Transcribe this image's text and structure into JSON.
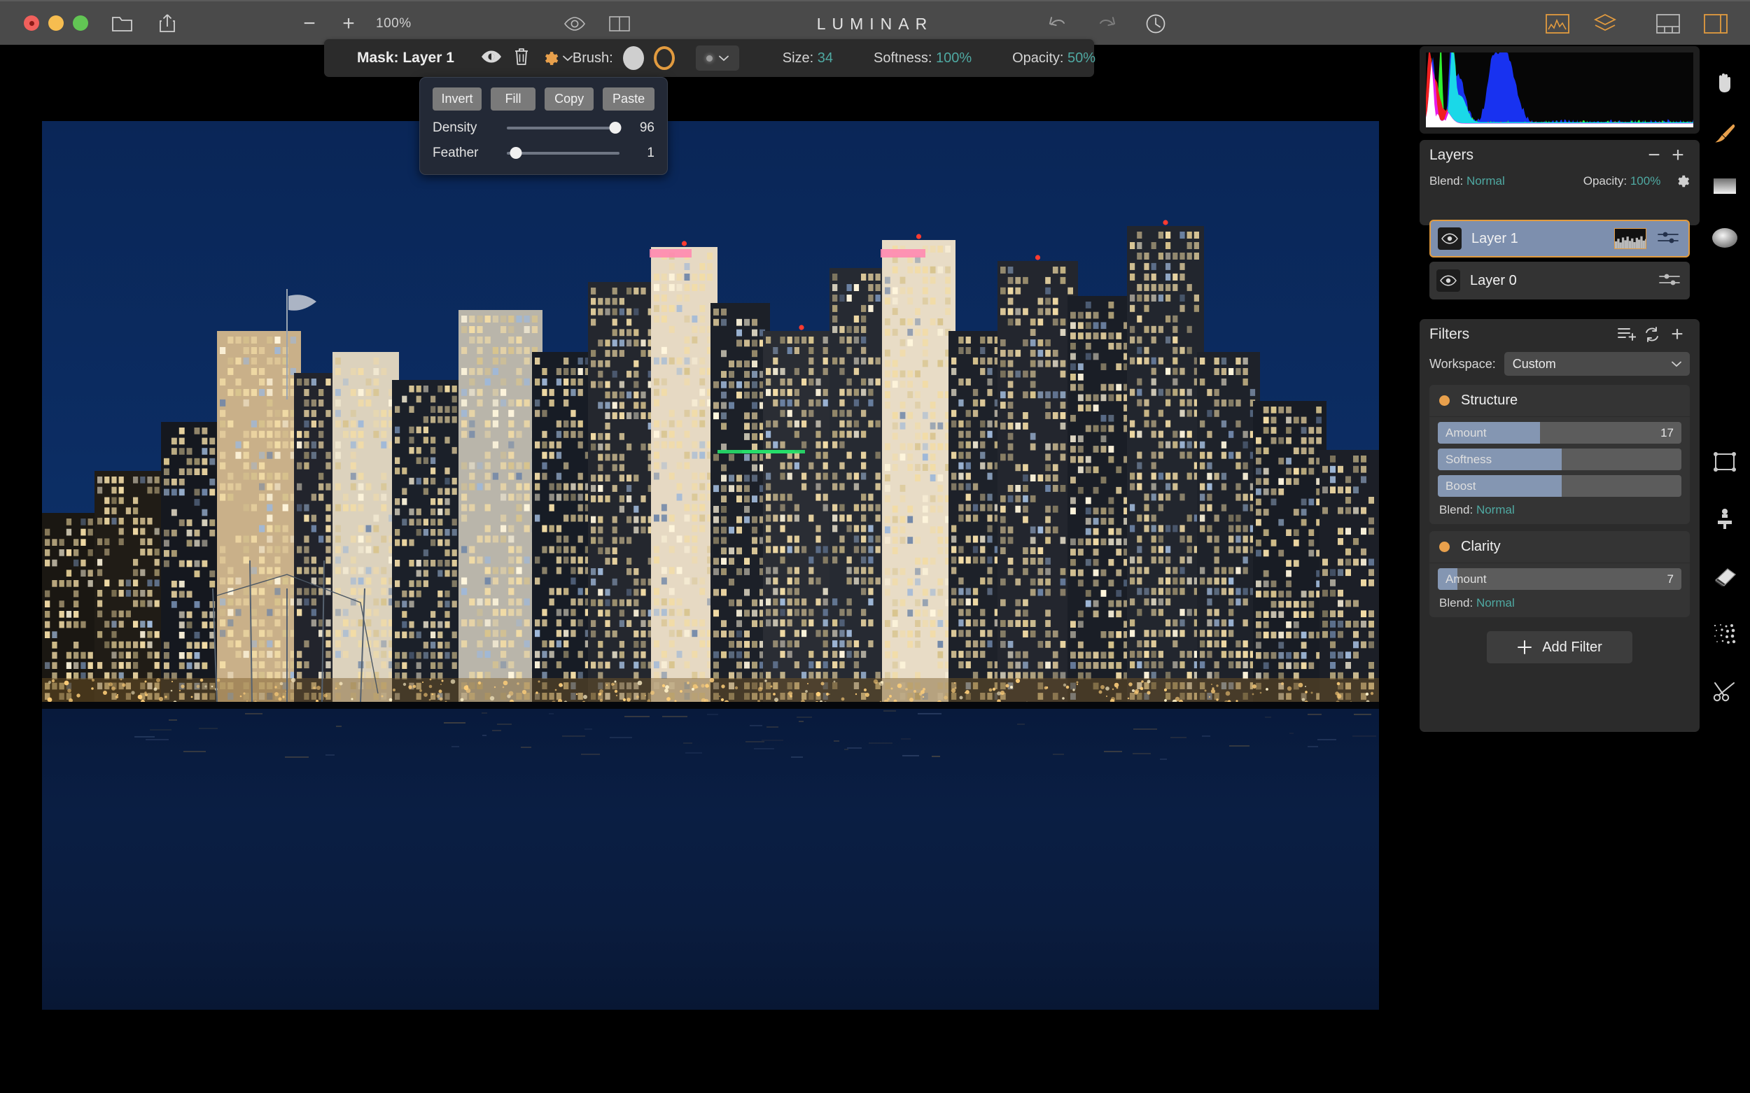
{
  "titlebar": {
    "zoom_out_label": "−",
    "zoom_in_label": "+",
    "zoom_level": "100%",
    "app_title": "LUMINAR",
    "icons": {
      "open_folder": "folder-icon",
      "share": "share-icon",
      "compare_eye": "compare-eye-icon",
      "split_view": "split-view-icon",
      "undo": "undo-icon",
      "redo": "redo-icon",
      "history": "history-clock-icon",
      "histogram_panel": "histogram-panel-icon",
      "layers_panel": "layers-panel-icon",
      "filmstrip_panel": "filmstrip-panel-icon",
      "side_panel": "side-panel-icon"
    }
  },
  "mask_toolbar": {
    "title": "Mask: Layer 1",
    "show_mask_icon": "eye-icon",
    "delete_mask_icon": "trash-icon",
    "mask_settings_icon": "gear-icon",
    "brush_label": "Brush:",
    "brush_solid_name": "brush-solid",
    "brush_ring_name": "brush-erase-ring",
    "brush_preset_icon": "brush-preset-dropdown",
    "size_label": "Size:",
    "size_value": "34",
    "softness_label": "Softness:",
    "softness_value": "100%",
    "opacity_label": "Opacity:",
    "opacity_value": "50%"
  },
  "mask_popover": {
    "buttons": [
      "Invert",
      "Fill",
      "Copy",
      "Paste"
    ],
    "density_label": "Density",
    "density_value": "96",
    "density_percent": 96,
    "feather_label": "Feather",
    "feather_value": "1",
    "feather_percent": 8
  },
  "histogram": {
    "left_marker": "shadow-clip-triangle",
    "right_marker": "highlight-clip-triangle"
  },
  "layers": {
    "title": "Layers",
    "remove_label": "−",
    "add_label": "+",
    "blend_label": "Blend:",
    "blend_value": "Normal",
    "opacity_label": "Opacity:",
    "opacity_value": "100%",
    "settings_icon": "gear-icon",
    "items": [
      {
        "name": "Layer 1",
        "selected": true,
        "has_mask_thumb": true
      },
      {
        "name": "Layer 0",
        "selected": false,
        "has_mask_thumb": false
      }
    ]
  },
  "filters": {
    "title": "Filters",
    "save_preset_icon": "save-preset-icon",
    "reset_icon": "reset-icon",
    "add_icon": "plus-icon",
    "workspace_label": "Workspace:",
    "workspace_value": "Custom",
    "add_filter_label": "Add Filter",
    "cards": [
      {
        "name": "Structure",
        "enabled": true,
        "sliders": [
          {
            "label": "Amount",
            "value": "17",
            "percent": 42,
            "variant": "value"
          },
          {
            "label": "Softness",
            "value": "",
            "percent": 51,
            "variant": "plain"
          },
          {
            "label": "Boost",
            "value": "",
            "percent": 51,
            "variant": "plain"
          }
        ],
        "blend_label": "Blend:",
        "blend_value": "Normal"
      },
      {
        "name": "Clarity",
        "enabled": true,
        "sliders": [
          {
            "label": "Amount",
            "value": "7",
            "percent": 8,
            "variant": "value"
          }
        ],
        "blend_label": "Blend:",
        "blend_value": "Normal"
      }
    ]
  },
  "tool_rail": {
    "tools": [
      {
        "icon": "hand-tool-icon",
        "active": false
      },
      {
        "icon": "brush-tool-icon",
        "active": true
      },
      {
        "icon": "gradient-mask-icon",
        "active": false
      },
      {
        "icon": "radial-mask-icon",
        "active": false
      },
      {
        "icon": "crop-tool-icon",
        "active": false
      },
      {
        "icon": "clone-stamp-icon",
        "active": false
      },
      {
        "icon": "erase-tool-icon",
        "active": false
      },
      {
        "icon": "denoise-tool-icon",
        "active": false
      },
      {
        "icon": "scissors-tool-icon",
        "active": false
      }
    ]
  },
  "canvas": {
    "image_name": "san-diego-skyline-night-photo",
    "sky_color": "#0b2a5e",
    "water_color": "#0a1c3e"
  },
  "colors": {
    "accent": "#e29b3f",
    "teal_value": "#4fa9a2",
    "selection": "#7d8fae",
    "panel_bg": "#2b2b2b",
    "titlebar_bg": "#4a4a4a"
  }
}
